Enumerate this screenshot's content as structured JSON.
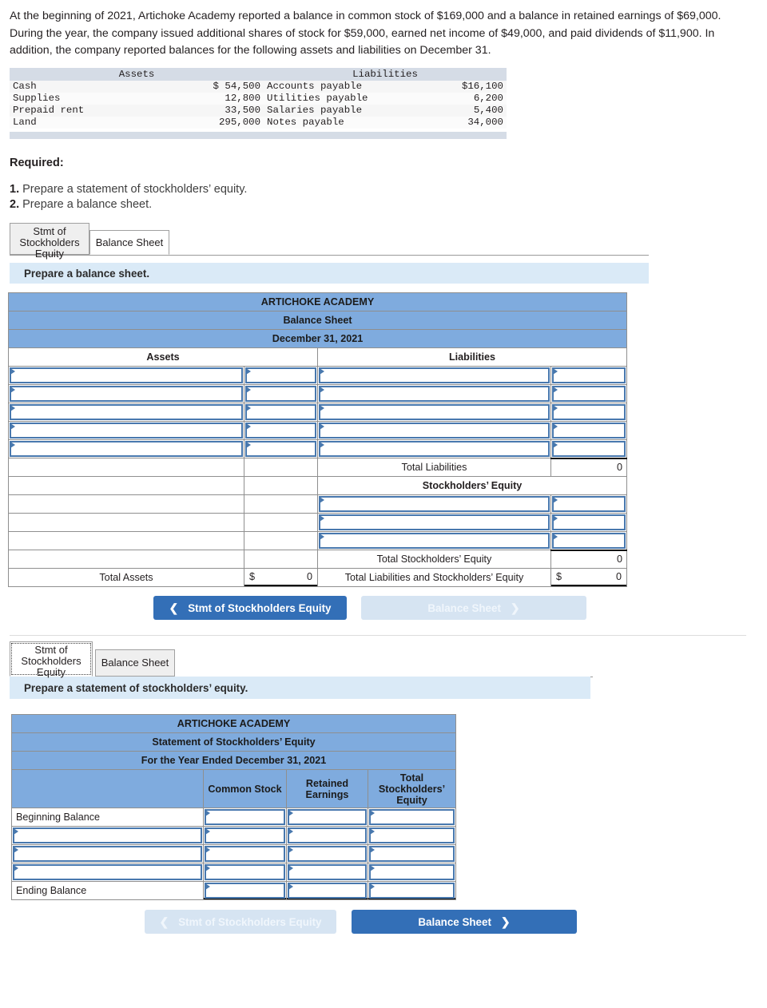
{
  "problem": {
    "text": "At the beginning of 2021, Artichoke Academy reported a balance in common stock of $169,000 and a balance in retained earnings of $69,000. During the year, the company issued additional shares of stock for $59,000, earned net income of $49,000, and paid dividends of $11,900. In addition, the company reported balances for the following assets and liabilities on December 31."
  },
  "given_table": {
    "headers": [
      "Assets",
      "Liabilities"
    ],
    "rows": [
      {
        "asset": "Cash",
        "asset_amount": "$ 54,500",
        "liability": "Accounts payable",
        "liability_amount": "$16,100"
      },
      {
        "asset": "Supplies",
        "asset_amount": "12,800",
        "liability": "Utilities payable",
        "liability_amount": "6,200"
      },
      {
        "asset": "Prepaid rent",
        "asset_amount": "33,500",
        "liability": "Salaries payable",
        "liability_amount": "5,400"
      },
      {
        "asset": "Land",
        "asset_amount": "295,000",
        "liability": "Notes payable",
        "liability_amount": "34,000"
      }
    ]
  },
  "required": {
    "heading": "Required:",
    "items": [
      {
        "num": "1.",
        "text": "Prepare a statement of stockholders’ equity."
      },
      {
        "num": "2.",
        "text": "Prepare a balance sheet."
      }
    ]
  },
  "tabs": {
    "stmt_label": "Stmt of Stockholders Equity",
    "balance_label": "Balance Sheet"
  },
  "section_balance": {
    "instruction": "Prepare a balance sheet.",
    "active_tab": "Balance Sheet",
    "table": {
      "company": "ARTICHOKE ACADEMY",
      "statement": "Balance Sheet",
      "date": "December 31, 2021",
      "assets_header": "Assets",
      "liabilities_header": "Liabilities",
      "total_liabilities_label": "Total Liabilities",
      "total_liabilities_value": "0",
      "stockholders_equity_header": "Stockholders’ Equity",
      "total_stockholders_equity_label": "Total Stockholders’ Equity",
      "total_stockholders_equity_value": "0",
      "total_assets_label": "Total Assets",
      "total_assets_currency": "$",
      "total_assets_value": "0",
      "total_liab_and_equity_label": "Total Liabilities and Stockholders’ Equity",
      "total_liab_and_equity_currency": "$",
      "total_liab_and_equity_value": "0",
      "asset_input_rows": 5,
      "liability_input_rows": 5,
      "equity_input_rows": 3
    },
    "nav": {
      "prev_label": "Stmt of Stockholders Equity",
      "prev_icon": "chevron-left-icon",
      "prev_state": "enabled",
      "next_label": "Balance Sheet",
      "next_icon": "chevron-right-icon",
      "next_state": "disabled"
    }
  },
  "section_equity": {
    "instruction": "Prepare a statement of stockholders’ equity.",
    "active_tab": "Stmt of Stockholders Equity",
    "table": {
      "company": "ARTICHOKE ACADEMY",
      "statement": "Statement of Stockholders’ Equity",
      "date": "For the Year Ended December 31, 2021",
      "columns": [
        "",
        "Common Stock",
        "Retained Earnings",
        "Total Stockholders’ Equity"
      ],
      "rows": [
        {
          "label": "Beginning Balance",
          "label_is_input": false
        },
        {
          "label": "",
          "label_is_input": true
        },
        {
          "label": "",
          "label_is_input": true
        },
        {
          "label": "",
          "label_is_input": true
        },
        {
          "label": "Ending Balance",
          "label_is_input": false
        }
      ]
    },
    "nav": {
      "prev_label": "Stmt of Stockholders Equity",
      "prev_icon": "chevron-left-icon",
      "prev_state": "disabled",
      "next_label": "Balance Sheet",
      "next_icon": "chevron-right-icon",
      "next_state": "enabled"
    }
  },
  "colors": {
    "header_blue": "#7fabde",
    "instruction_blue": "#daeaf7",
    "button_blue": "#336fb7",
    "button_disabled": "#d6e4f2",
    "input_border": "#4878ae",
    "given_header_grey": "#d5dce6"
  }
}
